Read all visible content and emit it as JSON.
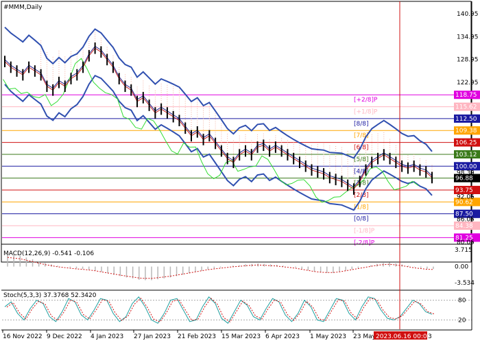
{
  "chart_data": {
    "type": "line",
    "symbol": "#MMM,Daily",
    "price_axis": {
      "min": 80.05,
      "max": 142.0,
      "ticks": [
        140.05,
        134.05,
        128.05,
        122.05,
        98.3,
        92.05,
        86.05,
        80.05
      ],
      "tick_labels": [
        "140.05",
        "134.05",
        "128.05",
        "122.05",
        "98.30",
        "92.05",
        "86.05",
        "80.05"
      ]
    },
    "dates": [
      "16 Nov 2022",
      "9 Dec 2022",
      "4 Jan 2023",
      "27 Jan 2023",
      "21 Feb 2023",
      "15 Mar 2023",
      "6 Apr 2023",
      "1 May 2023",
      "23 May 2023"
    ],
    "date_cursor": "2023.06.16 00:00",
    "date_cursor_tail": "3",
    "murrey_levels": [
      {
        "label": "[+2/8]P",
        "value": 118.75,
        "tag": "118.75",
        "color": "#e000e0"
      },
      {
        "label": "[+1/8]P",
        "value": 115.62,
        "tag": "115.62",
        "color": "#ffb6c1"
      },
      {
        "label": "[8/8]",
        "value": 112.5,
        "tag": "112.50",
        "color": "#1a1aa0"
      },
      {
        "label": "[7/8]",
        "value": 109.38,
        "tag": "109.38",
        "color": "#ffa500"
      },
      {
        "label": "[6/8]",
        "value": 106.25,
        "tag": "106.25",
        "color": "#d01010"
      },
      {
        "label": "[5/8]",
        "value": 103.12,
        "tag": "103.12",
        "color": "#3a7a1a"
      },
      {
        "label": "[4/8]",
        "value": 100.0,
        "tag": "100.00",
        "color": "#1a1aa0"
      },
      {
        "label": "[3/8]",
        "value": 96.88,
        "tag": "96.88",
        "color": "#3a7a1a"
      },
      {
        "label": "[2/8]",
        "value": 93.75,
        "tag": "93.75",
        "color": "#d01010"
      },
      {
        "label": "[1/8]",
        "value": 90.62,
        "tag": "90.62",
        "color": "#ffa500"
      },
      {
        "label": "[0/8]",
        "value": 87.5,
        "tag": "87.50",
        "color": "#1a1aa0"
      },
      {
        "label": "[-1/8]P",
        "value": 84.38,
        "tag": "84.38",
        "color": "#ffb6c1"
      },
      {
        "label": "[-2/8]P",
        "value": 81.25,
        "tag": "81.25",
        "color": "#e000e0"
      }
    ],
    "current_price": {
      "value": 96.88,
      "tag": "96.88"
    },
    "price_series": [
      127.5,
      126,
      125,
      124,
      126,
      125,
      124,
      121,
      120,
      122,
      121,
      123,
      124,
      126,
      129,
      131,
      130,
      128,
      126,
      123,
      121,
      120,
      117,
      118,
      116,
      114,
      115,
      114,
      113,
      112,
      110,
      108,
      109,
      107,
      108,
      106,
      104,
      102,
      101,
      103,
      104,
      103,
      105,
      105.5,
      104,
      105,
      104,
      103,
      102,
      101,
      100,
      99,
      98.5,
      98,
      97,
      96.5,
      96,
      95,
      94,
      96,
      99,
      101,
      102,
      103,
      102,
      101,
      100,
      99.5,
      100,
      99,
      98.5,
      97
    ],
    "macd": {
      "label": "MACD(12,26,9) -0.541 -0.106",
      "ticks": [
        "3.715",
        "0.00",
        "-3.534"
      ],
      "min": -3.534,
      "max": 3.715,
      "values": [
        2.8,
        2.6,
        2.4,
        2.0,
        1.6,
        1.2,
        0.8,
        0.5,
        0.2,
        0.0,
        -0.2,
        -0.4,
        -0.5,
        -0.7,
        -0.9,
        -1.2,
        -1.5,
        -1.8,
        -2.1,
        -2.4,
        -2.6,
        -2.9,
        -3.0,
        -3.0,
        -2.8,
        -2.6,
        -2.4,
        -2.1,
        -1.8,
        -1.5,
        -1.2,
        -0.9,
        -0.6,
        -0.4,
        -0.2,
        0.0,
        0.2,
        0.3,
        0.5,
        0.6,
        0.7,
        0.6,
        0.5,
        0.4,
        0.2,
        0.0,
        -0.2,
        -0.5,
        -0.8,
        -1.1,
        -1.3,
        -1.4,
        -1.4,
        -1.2,
        -0.9,
        -0.6,
        -0.3,
        0.0,
        0.3,
        0.6,
        0.8,
        0.9,
        0.7,
        0.5,
        0.2,
        -0.1,
        -0.3,
        -0.5,
        -0.54
      ]
    },
    "stoch": {
      "label": "Stoch(5,3,3) 37.3768 52.3420",
      "ticks": [
        "80",
        "20"
      ],
      "min": 0,
      "max": 100,
      "values": [
        60,
        75,
        40,
        20,
        55,
        80,
        70,
        30,
        15,
        45,
        85,
        75,
        35,
        20,
        50,
        85,
        80,
        40,
        15,
        30,
        70,
        90,
        60,
        20,
        10,
        40,
        80,
        85,
        50,
        15,
        20,
        60,
        90,
        70,
        25,
        10,
        45,
        80,
        65,
        30,
        20,
        55,
        85,
        75,
        35,
        15,
        40,
        80,
        60,
        20,
        15,
        50,
        85,
        80,
        40,
        20,
        60,
        90,
        85,
        50,
        25,
        20,
        30,
        55,
        80,
        70,
        45,
        37
      ]
    }
  }
}
